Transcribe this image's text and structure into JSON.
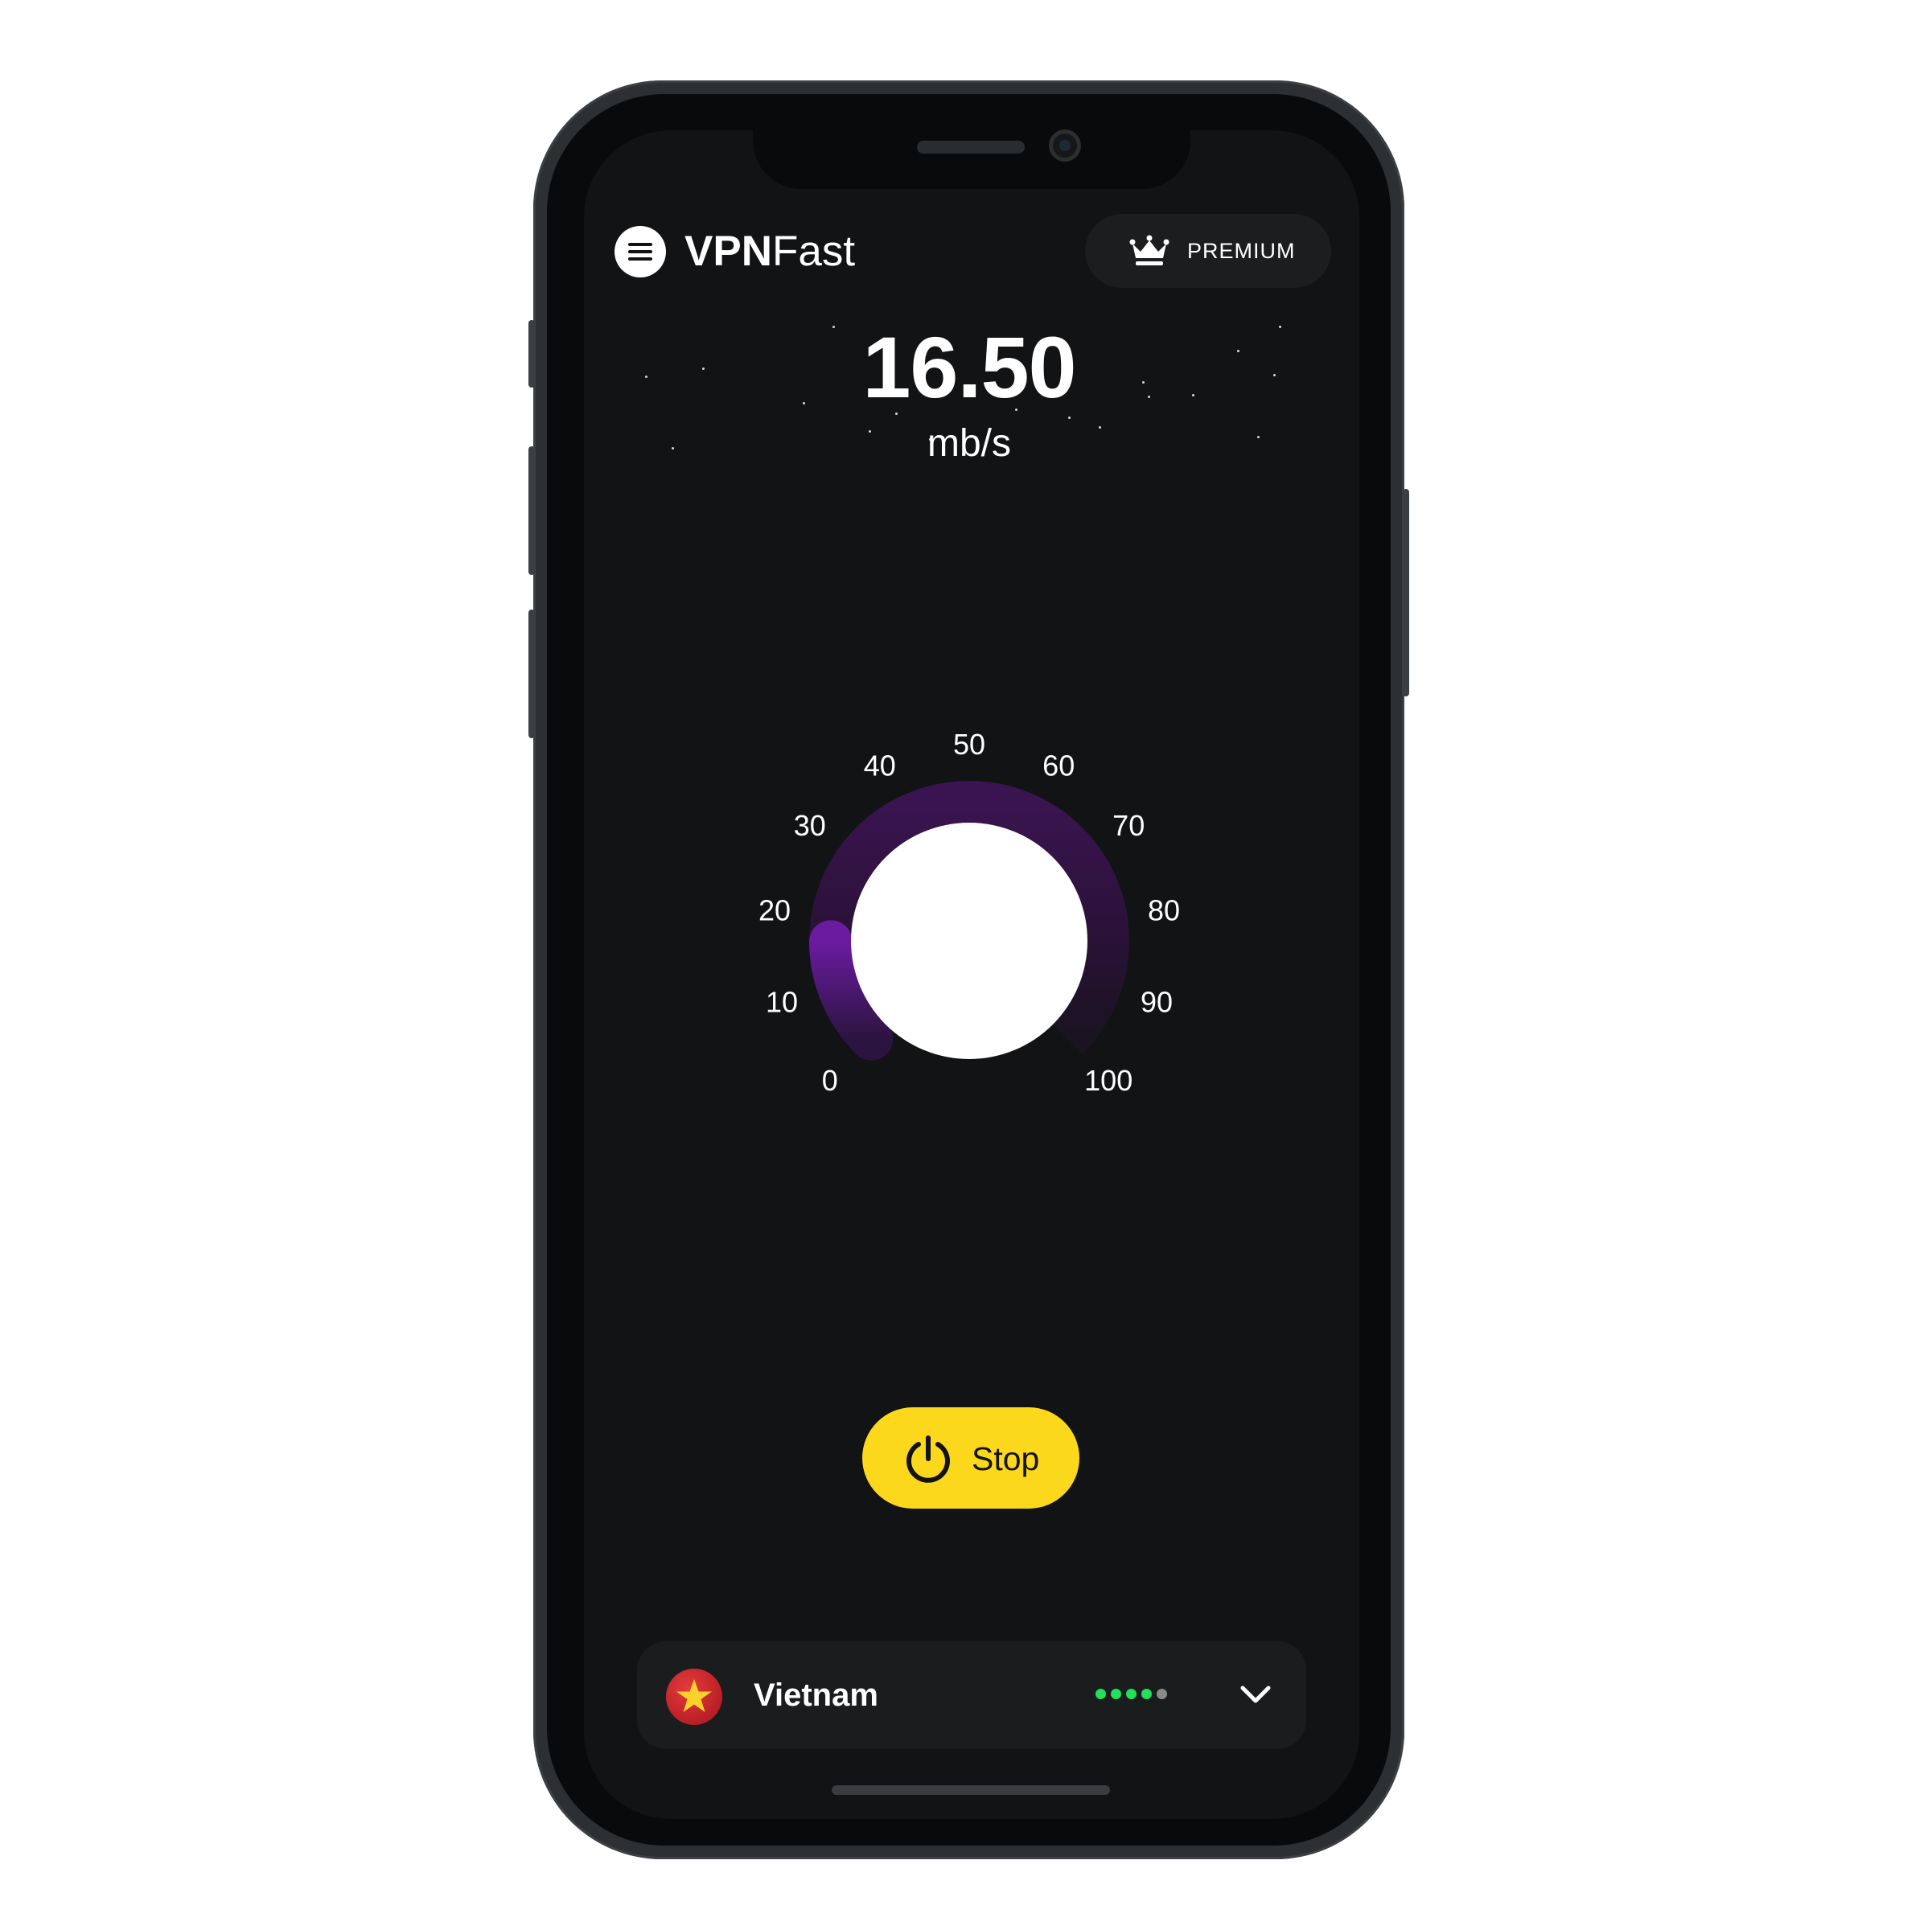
{
  "app": {
    "brand_bold": "VPN",
    "brand_regular": "Fast"
  },
  "header": {
    "menu_icon": "hamburger-menu-icon",
    "premium_icon": "crown-icon",
    "premium_label": "PREMIUM"
  },
  "speed": {
    "value": "16.50",
    "unit": "mb/s",
    "level": 16.5
  },
  "gauge": {
    "min": 0,
    "max": 100,
    "ticks": [
      "0",
      "10",
      "20",
      "30",
      "40",
      "50",
      "60",
      "70",
      "80",
      "90",
      "100"
    ]
  },
  "action": {
    "stop_label": "Stop",
    "icon": "power-icon"
  },
  "location": {
    "country": "Vietnam",
    "flag_icon": "vietnam-flag-icon",
    "signal_total": 5,
    "signal_active": 4,
    "expand_icon": "chevron-down-icon"
  },
  "colors": {
    "background": "#121314",
    "accent_yellow": "#fcd81c",
    "gauge_track": "#3a1450",
    "gauge_fill": "#6a1ba0",
    "signal_active": "#22e05a",
    "signal_inactive": "#8a8a8a"
  }
}
